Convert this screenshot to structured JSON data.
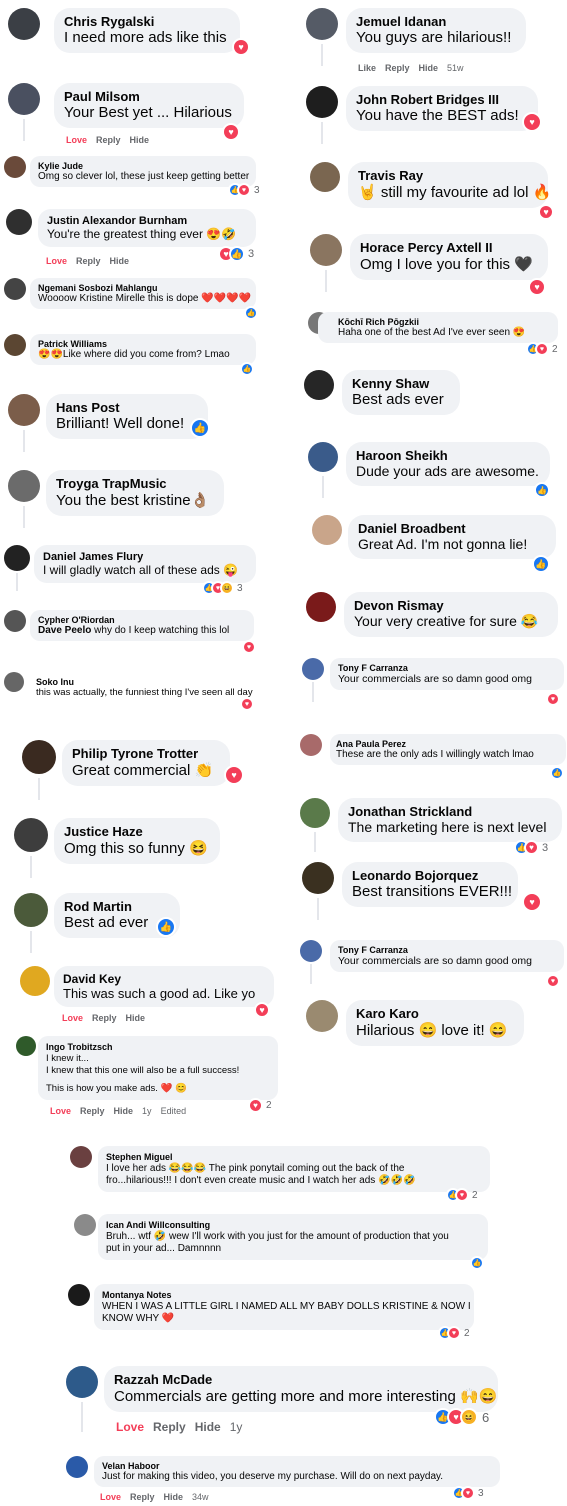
{
  "ui": {
    "actions": {
      "love": "Love",
      "like": "Like",
      "reply": "Reply",
      "hide": "Hide",
      "edited": "Edited"
    },
    "icons": {
      "like": "👍",
      "love": "♥",
      "haha": "😆"
    }
  },
  "left": [
    {
      "name": "Chris Rygalski",
      "text": "I need more ads like this",
      "reactions": [
        "love"
      ],
      "count": ""
    },
    {
      "name": "Paul Milsom",
      "text": "Your Best yet ... Hilarious",
      "reactions": [
        "love"
      ],
      "count": ""
    },
    {
      "name": "Kylie Jude",
      "text": "Omg so clever lol, these just keep getting better",
      "reactions": [
        "like",
        "love"
      ],
      "count": "3"
    },
    {
      "name": "Justin Alexandor Burnham",
      "text": "You're the greatest thing ever 😍🤣",
      "reactions": [
        "love",
        "like"
      ],
      "count": "3"
    },
    {
      "name": "Ngemani Sosbozi Mahlangu",
      "text": "Woooow Kristine Mirelle this is dope ❤️❤️❤️❤️",
      "reactions": [
        "like"
      ],
      "count": ""
    },
    {
      "name": "Patrick Williams",
      "text": "😍😍Like where did you come from? Lmao",
      "reactions": [
        "like"
      ],
      "count": ""
    },
    {
      "name": "Hans Post",
      "text": "Brilliant! Well done!",
      "reactions": [
        "like"
      ],
      "count": ""
    },
    {
      "name": "Troyga TrapMusic",
      "text": "You the best kristine👌🏽",
      "reactions": [],
      "count": ""
    },
    {
      "name": "Daniel James Flury",
      "text": "I will gladly watch all of these ads 😜",
      "reactions": [
        "like",
        "love",
        "haha"
      ],
      "count": "3"
    },
    {
      "name": "Cypher O'Riordan",
      "reply_to": "Dave Peelo",
      "text": "why do I keep watching this lol",
      "reactions": [
        "love"
      ],
      "count": ""
    },
    {
      "name": "Soko Inu",
      "text": "this was actually, the funniest thing I've seen all day",
      "reactions": [
        "love"
      ],
      "count": ""
    },
    {
      "name": "Philip Tyrone Trotter",
      "text": "Great commercial 👏",
      "reactions": [
        "love"
      ],
      "count": ""
    },
    {
      "name": "Justice Haze",
      "text": "Omg this so funny 😆",
      "reactions": [],
      "count": ""
    },
    {
      "name": "Rod Martin",
      "text": "Best ad ever",
      "reactions": [
        "like"
      ],
      "count": ""
    },
    {
      "name": "David Key",
      "text": "This was such a good ad. Like yo",
      "reactions": [
        "love"
      ],
      "count": ""
    },
    {
      "name": "Ingo Trobitzsch",
      "text_lines": [
        "I knew it...",
        "I knew that this one will also be a full success!",
        "",
        "This is how you make ads. ❤️ 😊"
      ],
      "reactions": [
        "love"
      ],
      "count": "2",
      "time": "1y"
    }
  ],
  "right": [
    {
      "name": "Jemuel Idanan",
      "text": "You guys are hilarious!!",
      "reactions": [],
      "count": "",
      "time": "51w"
    },
    {
      "name": "John Robert Bridges III",
      "text": "You have the BEST ads!",
      "reactions": [
        "love"
      ],
      "count": ""
    },
    {
      "name": "Travis Ray",
      "text": "🤘 still my favourite ad lol 🔥",
      "reactions": [
        "love"
      ],
      "count": ""
    },
    {
      "name": "Horace Percy Axtell II",
      "text": "Omg I love you for this 🖤",
      "reactions": [
        "love"
      ],
      "count": ""
    },
    {
      "name": "Kōchī Rich Pōgzkii",
      "text": "Haha one of the best Ad I've ever seen 😍",
      "reactions": [
        "like",
        "love"
      ],
      "count": "2"
    },
    {
      "name": "Kenny Shaw",
      "text": "Best ads ever",
      "reactions": [],
      "count": ""
    },
    {
      "name": "Haroon Sheikh",
      "text": "Dude your ads are awesome.",
      "reactions": [
        "like"
      ],
      "count": ""
    },
    {
      "name": "Daniel Broadbent",
      "text": "Great Ad. I'm not gonna lie!",
      "reactions": [
        "like"
      ],
      "count": ""
    },
    {
      "name": "Devon Rismay",
      "text": "Your very creative for sure 😂",
      "reactions": [],
      "count": ""
    },
    {
      "name": "Tony F Carranza",
      "text": "Your commercials are so damn good omg",
      "reactions": [
        "love"
      ],
      "count": ""
    },
    {
      "name": "Ana Paula Perez",
      "text": "These are the only ads I willingly watch lmao",
      "reactions": [
        "like"
      ],
      "count": ""
    },
    {
      "name": "Jonathan Strickland",
      "text": "The marketing here is next level",
      "reactions": [
        "like",
        "love"
      ],
      "count": "3"
    },
    {
      "name": "Leonardo Bojorquez",
      "text": "Best transitions EVER!!!",
      "reactions": [
        "love"
      ],
      "count": ""
    },
    {
      "name": "Tony F Carranza",
      "text": "Your commercials are so damn good omg",
      "reactions": [
        "love"
      ],
      "count": ""
    },
    {
      "name": "Karo Karo",
      "text": "Hilarious 😄 love it! 😄",
      "reactions": [],
      "count": ""
    }
  ],
  "bottom": [
    {
      "name": "Stephen Miguel",
      "text_lines": [
        "I love her ads 😂😂😂 The pink ponytail coming out the back of the",
        "fro...hilarious!!! I don't even create music and I watch her ads 🤣🤣🤣"
      ],
      "reactions": [
        "like",
        "love"
      ],
      "count": "2"
    },
    {
      "name": "Ican Andi Willconsulting",
      "text_lines": [
        "Bruh... wtf 🤣 wew I'll work with you just for the amount of production that you",
        "put in your ad... Damnnnn"
      ],
      "reactions": [
        "like"
      ],
      "count": ""
    },
    {
      "name": "Montanya Notes",
      "text_lines": [
        "WHEN I WAS A LITTLE GIRL I NAMED ALL MY BABY DOLLS KRISTINE & NOW I",
        "KNOW WHY ❤️"
      ],
      "reactions": [
        "like",
        "love"
      ],
      "count": "2"
    },
    {
      "name": "Razzah McDade",
      "text": "Commercials are getting more and more interesting 🙌😄",
      "reactions": [
        "like",
        "love",
        "haha"
      ],
      "count": "6",
      "time": "1y"
    },
    {
      "name": "Velan Haboor",
      "text_lines": [
        "Just for making this video, you deserve my purchase. Will do on next payday."
      ],
      "reactions": [
        "like",
        "love"
      ],
      "count": "3",
      "time": "34w"
    }
  ]
}
